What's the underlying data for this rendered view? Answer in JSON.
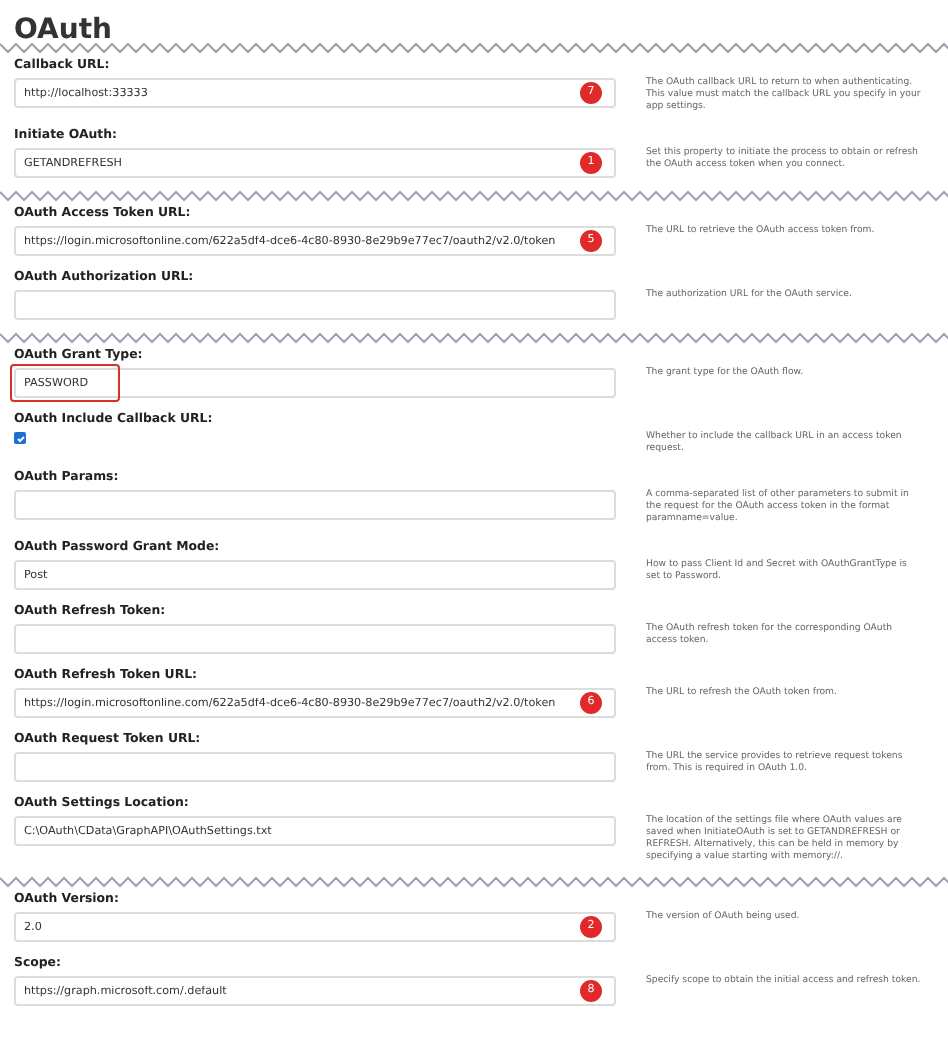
{
  "title": "OAuth",
  "title_break": true,
  "fields": [
    {
      "kind": "text",
      "label": "Callback URL:",
      "value": "http://localhost:33333",
      "badge": "7",
      "highlighted": false,
      "description": "The OAuth callback URL to return to when authenticating. This value must match the callback URL you specify in your app settings.",
      "break_after": false
    },
    {
      "kind": "text",
      "label": "Initiate OAuth:",
      "value": "GETANDREFRESH",
      "badge": "1",
      "highlighted": false,
      "description": "Set this property to initiate the process to obtain or refresh the OAuth access token when you connect.",
      "break_after": true
    },
    {
      "kind": "text",
      "label": "OAuth Access Token URL:",
      "value": "https://login.microsoftonline.com/622a5df4-dce6-4c80-8930-8e29b9e77ec7/oauth2/v2.0/token",
      "badge": "5",
      "highlighted": false,
      "description": "The URL to retrieve the OAuth access token from.",
      "break_after": false
    },
    {
      "kind": "text",
      "label": "OAuth Authorization URL:",
      "highlighted": false,
      "description": "The authorization URL for the OAuth service.",
      "break_after": true
    },
    {
      "kind": "text",
      "label": "OAuth Grant Type:",
      "value": "PASSWORD",
      "highlighted": true,
      "description": "The grant type for the OAuth flow.",
      "break_after": false
    },
    {
      "kind": "checkbox",
      "label": "OAuth Include Callback URL:",
      "checked": true,
      "description": "Whether to include the callback URL in an access token request.",
      "break_after": false
    },
    {
      "kind": "text",
      "label": "OAuth Params:",
      "highlighted": false,
      "description": "A comma-separated list of other parameters to submit in the request for the OAuth access token in the format paramname=value.",
      "break_after": false
    },
    {
      "kind": "text",
      "label": "OAuth Password Grant Mode:",
      "value": "Post",
      "highlighted": false,
      "description": "How to pass Client Id and Secret with OAuthGrantType is set to Password.",
      "break_after": false
    },
    {
      "kind": "text",
      "label": "OAuth Refresh Token:",
      "highlighted": false,
      "description": "The OAuth refresh token for the corresponding OAuth access token.",
      "break_after": false
    },
    {
      "kind": "text",
      "label": "OAuth Refresh Token URL:",
      "value": "https://login.microsoftonline.com/622a5df4-dce6-4c80-8930-8e29b9e77ec7/oauth2/v2.0/token",
      "badge": "6",
      "highlighted": false,
      "description": "The URL to refresh the OAuth token from.",
      "break_after": false
    },
    {
      "kind": "text",
      "label": "OAuth Request Token URL:",
      "highlighted": false,
      "description": "The URL the service provides to retrieve request tokens from. This is required in OAuth 1.0.",
      "break_after": false
    },
    {
      "kind": "text",
      "label": "OAuth Settings Location:",
      "value": "C:\\OAuth\\CData\\GraphAPI\\OAuthSettings.txt",
      "highlighted": false,
      "description": "The location of the settings file where OAuth values are saved when InitiateOAuth is set to GETANDREFRESH or REFRESH. Alternatively, this can be held in memory by specifying a value starting with memory://.",
      "break_after": true
    },
    {
      "kind": "text",
      "label": "OAuth Version:",
      "value": "2.0",
      "badge": "2",
      "highlighted": false,
      "description": "The version of OAuth being used.",
      "break_after": false
    },
    {
      "kind": "text",
      "label": "Scope:",
      "value": "https://graph.microsoft.com/.default",
      "badge": "8",
      "highlighted": false,
      "description": "Specify scope to obtain the initial access and refresh token.",
      "break_after": false
    }
  ]
}
